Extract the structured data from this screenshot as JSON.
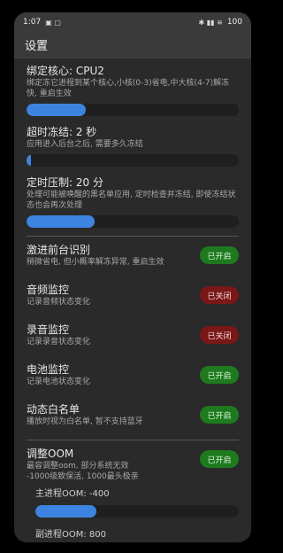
{
  "status_bar": {
    "time": "1:07",
    "notif_icons": "▣ ▢",
    "right_icons": "✱ ▮▮ ≋",
    "battery": "100"
  },
  "app_bar": {
    "title": "设置"
  },
  "sliders": [
    {
      "title": "绑定核心: CPU2",
      "desc": "绑定冻它进程到某个核心,小核(0-3)省电,中大核(4-7)解冻快, 重启生效",
      "value_pct": 28
    },
    {
      "title": "超时冻结: 2 秒",
      "desc": "应用进入后台之后, 需要多久冻结",
      "value_pct": 1
    },
    {
      "title": "定时压制: 20 分",
      "desc": "处理可能被唤醒的黑名单应用, 定时检查并冻结, 即使冻结状态也会再次处理",
      "value_pct": 32
    }
  ],
  "toggles": [
    {
      "title": "激进前台识别",
      "desc": "稍微省电, 但小概率解冻异常, 重启生效",
      "state_label": "已开启",
      "on": true
    },
    {
      "title": "音频监控",
      "desc": "记录音频状态变化",
      "state_label": "已关闭",
      "on": false
    },
    {
      "title": "录音监控",
      "desc": "记录录音状态变化",
      "state_label": "已关闭",
      "on": false
    },
    {
      "title": "电池监控",
      "desc": "记录电池状态变化",
      "state_label": "已开启",
      "on": true
    },
    {
      "title": "动态白名单",
      "desc": "播放时视为白名单, 暂不支持蓝牙",
      "state_label": "已开启",
      "on": true
    }
  ],
  "oom": {
    "title": "调整OOM",
    "desc_line1": "最容调整oom, 部分系统无效",
    "desc_line2": "-1000级致保活, 1000最头极亲",
    "state_label": "已开启",
    "on": true,
    "main_label": "主进程OOM: -400",
    "main_pct": 30,
    "sub_label": "副进程OOM: 800"
  }
}
